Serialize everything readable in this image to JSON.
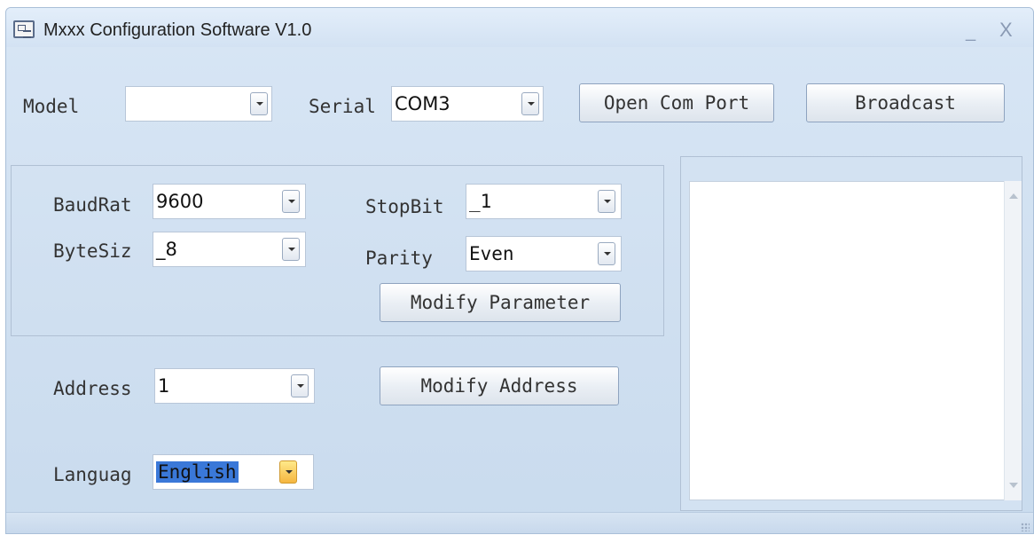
{
  "window": {
    "title": "Mxxx Configuration Software V1.0",
    "minimize_glyph": "_",
    "close_glyph": "X"
  },
  "top_row": {
    "model_label": "Model",
    "model_value": "",
    "serial_label": "Serial",
    "serial_value": "COM3",
    "open_port_label": "Open Com Port",
    "broadcast_label": "Broadcast"
  },
  "params": {
    "baudrate_label": "BaudRat",
    "baudrate_value": "9600",
    "stopbit_label": "StopBit",
    "stopbit_value": "_1",
    "bytesize_label": "ByteSiz",
    "bytesize_value": "_8",
    "parity_label": "Parity",
    "parity_value": "Even",
    "modify_param_label": "Modify Parameter"
  },
  "address": {
    "label": "Address",
    "value": "1",
    "modify_label": "Modify Address"
  },
  "language": {
    "label": "Languag",
    "value": "English"
  },
  "icons": [
    "app-icon",
    "dropdown-arrow-icon",
    "scroll-up-icon",
    "scroll-down-icon",
    "size-grip-icon"
  ]
}
